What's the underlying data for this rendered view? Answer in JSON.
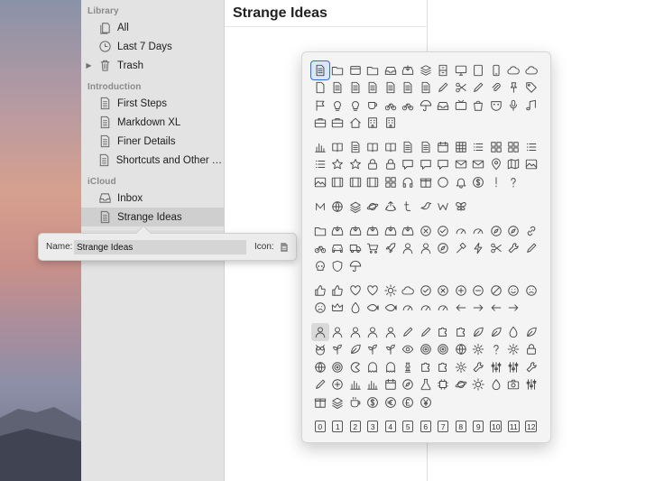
{
  "sidebar": {
    "sections": [
      {
        "header": "Library",
        "items": [
          {
            "label": "All",
            "icon": "documents-icon"
          },
          {
            "label": "Last 7 Days",
            "icon": "clock-icon"
          },
          {
            "label": "Trash",
            "icon": "trash-icon",
            "disclosure": "▶"
          }
        ]
      },
      {
        "header": "Introduction",
        "items": [
          {
            "label": "First Steps",
            "icon": "document-icon"
          },
          {
            "label": "Markdown XL",
            "icon": "document-icon"
          },
          {
            "label": "Finer Details",
            "icon": "document-icon"
          },
          {
            "label": "Shortcuts and Other Ti...",
            "icon": "document-icon"
          }
        ]
      },
      {
        "header": "iCloud",
        "items": [
          {
            "label": "Inbox",
            "icon": "inbox-icon"
          },
          {
            "label": "Strange Ideas",
            "icon": "document-icon",
            "selected": true
          }
        ]
      }
    ]
  },
  "editor": {
    "title": "Strange Ideas"
  },
  "rename_popover": {
    "name_label": "Name:",
    "name_value": "Strange Ideas",
    "icon_label": "Icon:"
  },
  "icon_picker": {
    "selected_icon": "document-text-icon",
    "numbers": [
      "0",
      "1",
      "2",
      "3",
      "4",
      "5",
      "6",
      "7",
      "8",
      "9",
      "10",
      "11",
      "12"
    ]
  },
  "colors": {
    "accent": "#2c6fd6",
    "sidebar_bg": "#e3e3e3",
    "selected_row": "#cfcfcf",
    "picker_bg": "#f4f4f4"
  }
}
